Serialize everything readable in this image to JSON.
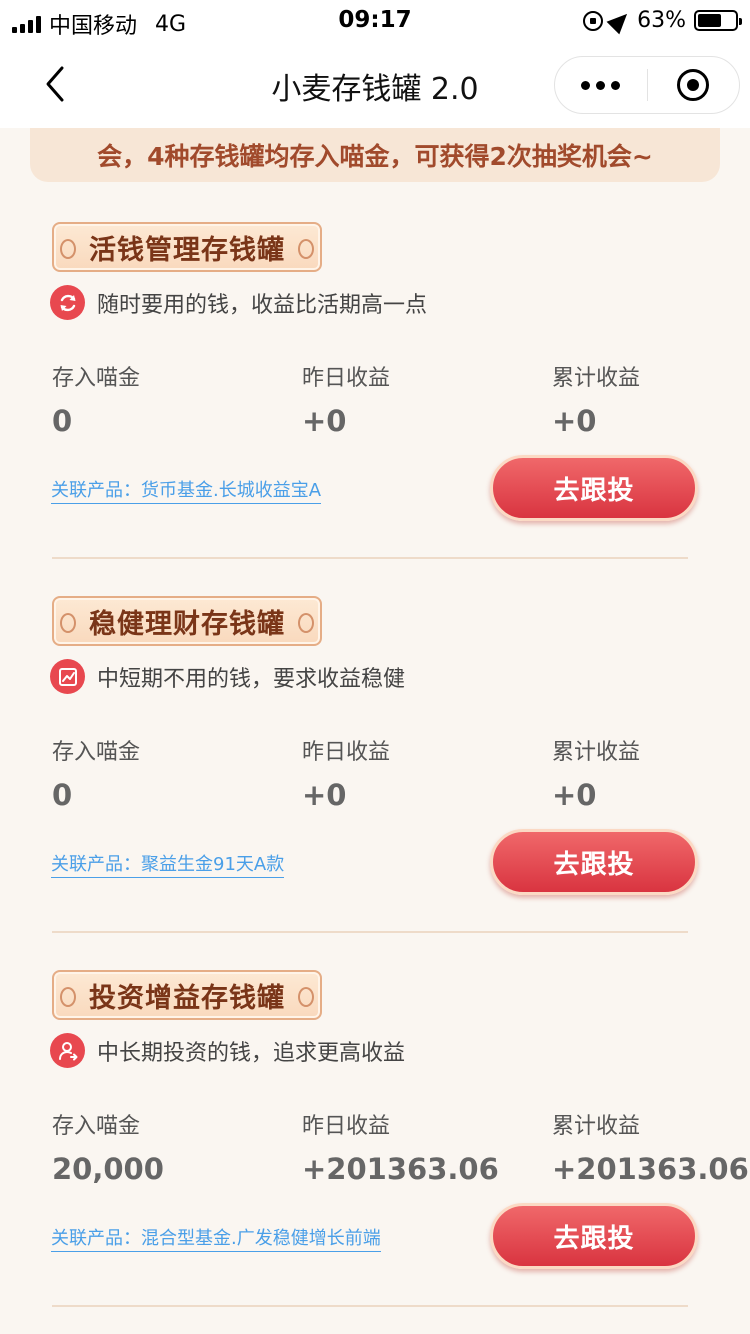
{
  "status_bar": {
    "carrier": "中国移动",
    "network": "4G",
    "time": "09:17",
    "battery": "63%",
    "battery_level": 0.63
  },
  "nav": {
    "title": "小麦存钱罐 2.0"
  },
  "notice": {
    "text": "会，4种存钱罐均存入喵金，可获得2次抽奖机会~"
  },
  "labels": {
    "deposit": "存入喵金",
    "yesterday": "昨日收益",
    "total": "累计收益",
    "follow": "去跟投"
  },
  "sections": [
    {
      "title": "活钱管理存钱罐",
      "icon": "refresh-icon",
      "desc": "随时要用的钱，收益比活期高一点",
      "deposit": "0",
      "yesterday": "+0",
      "total": "+0",
      "product": "关联产品：货币基金.长城收益宝A"
    },
    {
      "title": "稳健理财存钱罐",
      "icon": "trend-chart-icon",
      "desc": "中短期不用的钱，要求收益稳健",
      "deposit": "0",
      "yesterday": "+0",
      "total": "+0",
      "product": "关联产品：聚益生金91天A款"
    },
    {
      "title": "投资增益存钱罐",
      "icon": "user-invest-icon",
      "desc": "中长期投资的钱，追求更高收益",
      "deposit": "20,000",
      "yesterday": "+201363.06",
      "total": "+201363.06",
      "product": "关联产品：混合型基金.广发稳健增长前端"
    }
  ],
  "colors": {
    "accent_red": "#e8484f",
    "title_brown": "#7a3518",
    "link_blue": "#4a9fe8",
    "background": "#faf6f1"
  }
}
